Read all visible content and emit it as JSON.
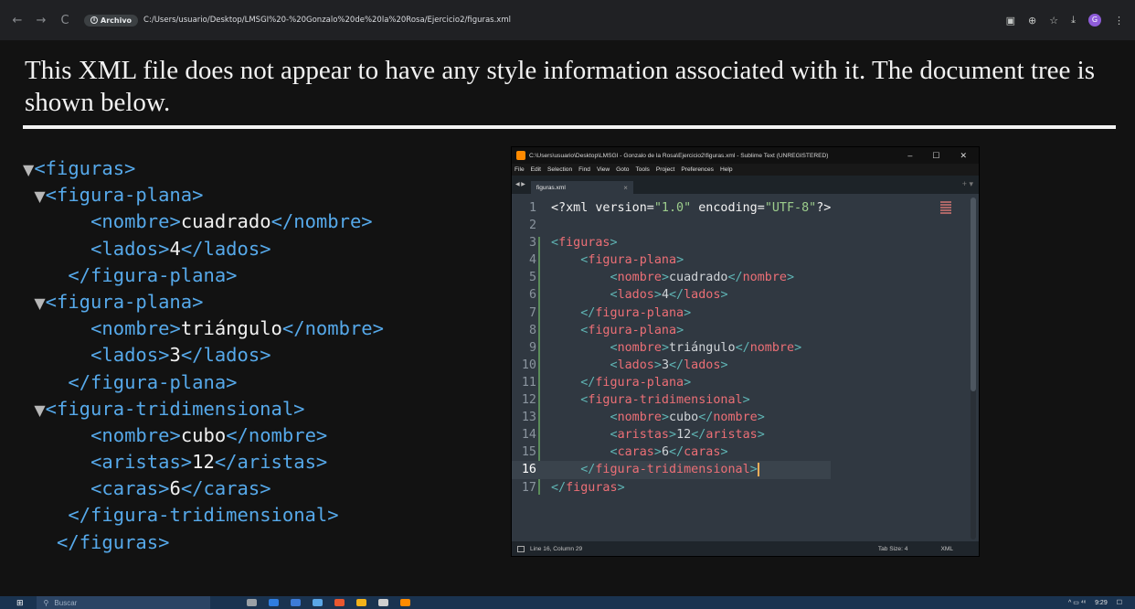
{
  "browser": {
    "back_icon": "←",
    "forward_icon": "→",
    "reload_icon": "C",
    "archivo_label": "Archivo",
    "url": "C:/Users/usuario/Desktop/LMSGI%20-%20Gonzalo%20de%20la%20Rosa/Ejercicio2/figuras.xml",
    "translate_icon": "▣",
    "zoom_icon": "⊕",
    "bookmark_icon": "☆",
    "download_icon": "⤓",
    "profile_initial": "G",
    "menu_icon": "⋮"
  },
  "xml_viewer": {
    "notice": "This XML file does not appear to have any style information associated with it. The document tree is shown below.",
    "tree": [
      {
        "indent": "",
        "tri": "▼",
        "open": "<figuras>",
        "text": "",
        "close": ""
      },
      {
        "indent": " ",
        "tri": "▼",
        "open": "<figura-plana>",
        "text": "",
        "close": ""
      },
      {
        "indent": "    ",
        "tri": "",
        "open": "<nombre>",
        "text": "cuadrado",
        "close": "</nombre>"
      },
      {
        "indent": "    ",
        "tri": "",
        "open": "<lados>",
        "text": "4",
        "close": "</lados>"
      },
      {
        "indent": "  ",
        "tri": "",
        "open": "</figura-plana>",
        "text": "",
        "close": ""
      },
      {
        "indent": " ",
        "tri": "▼",
        "open": "<figura-plana>",
        "text": "",
        "close": ""
      },
      {
        "indent": "    ",
        "tri": "",
        "open": "<nombre>",
        "text": "triángulo",
        "close": "</nombre>"
      },
      {
        "indent": "    ",
        "tri": "",
        "open": "<lados>",
        "text": "3",
        "close": "</lados>"
      },
      {
        "indent": "  ",
        "tri": "",
        "open": "</figura-plana>",
        "text": "",
        "close": ""
      },
      {
        "indent": " ",
        "tri": "▼",
        "open": "<figura-tridimensional>",
        "text": "",
        "close": ""
      },
      {
        "indent": "    ",
        "tri": "",
        "open": "<nombre>",
        "text": "cubo",
        "close": "</nombre>"
      },
      {
        "indent": "    ",
        "tri": "",
        "open": "<aristas>",
        "text": "12",
        "close": "</aristas>"
      },
      {
        "indent": "    ",
        "tri": "",
        "open": "<caras>",
        "text": "6",
        "close": "</caras>"
      },
      {
        "indent": "  ",
        "tri": "",
        "open": "</figura-tridimensional>",
        "text": "",
        "close": ""
      },
      {
        "indent": " ",
        "tri": "",
        "open": "</figuras>",
        "text": "",
        "close": ""
      }
    ]
  },
  "sublime": {
    "title": "C:\\Users\\usuario\\Desktop\\LMSGI - Gonzalo de la Rosa\\Ejercicio2\\figuras.xml - Sublime Text (UNREGISTERED)",
    "minimize_icon": "–",
    "maximize_icon": "☐",
    "close_icon": "✕",
    "menu": [
      "File",
      "Edit",
      "Selection",
      "Find",
      "View",
      "Goto",
      "Tools",
      "Project",
      "Preferences",
      "Help"
    ],
    "tab_nav": "◀ ▶",
    "tab_name": "figuras.xml",
    "tab_close": "×",
    "tab_add": "+ ▾",
    "current_line": 16,
    "code": [
      {
        "n": "1",
        "ind": "",
        "kind": "decl",
        "a": "<?xml version=",
        "b": "\"1.0\"",
        "c": " encoding=",
        "d": "\"UTF-8\"",
        "e": "?>"
      },
      {
        "n": "2",
        "ind": "",
        "kind": "blank"
      },
      {
        "n": "3",
        "ind": "",
        "kind": "tag",
        "open": "figuras"
      },
      {
        "n": "4",
        "ind": "    ",
        "kind": "tag",
        "open": "figura-plana"
      },
      {
        "n": "5",
        "ind": "        ",
        "kind": "el",
        "tag": "nombre",
        "val": "cuadrado"
      },
      {
        "n": "6",
        "ind": "        ",
        "kind": "el",
        "tag": "lados",
        "val": "4"
      },
      {
        "n": "7",
        "ind": "    ",
        "kind": "end",
        "close": "figura-plana"
      },
      {
        "n": "8",
        "ind": "    ",
        "kind": "tag",
        "open": "figura-plana"
      },
      {
        "n": "9",
        "ind": "        ",
        "kind": "el",
        "tag": "nombre",
        "val": "triángulo"
      },
      {
        "n": "10",
        "ind": "        ",
        "kind": "el",
        "tag": "lados",
        "val": "3"
      },
      {
        "n": "11",
        "ind": "    ",
        "kind": "end",
        "close": "figura-plana"
      },
      {
        "n": "12",
        "ind": "    ",
        "kind": "tag",
        "open": "figura-tridimensional"
      },
      {
        "n": "13",
        "ind": "        ",
        "kind": "el",
        "tag": "nombre",
        "val": "cubo"
      },
      {
        "n": "14",
        "ind": "        ",
        "kind": "el",
        "tag": "aristas",
        "val": "12"
      },
      {
        "n": "15",
        "ind": "        ",
        "kind": "el",
        "tag": "caras",
        "val": "6"
      },
      {
        "n": "16",
        "ind": "    ",
        "kind": "end",
        "close": "figura-tridimensional"
      },
      {
        "n": "17",
        "ind": "",
        "kind": "end",
        "close": "figuras"
      }
    ],
    "status_left": "Line 16, Column 29",
    "tab_size": "Tab Size: 4",
    "syntax": "XML"
  },
  "taskbar": {
    "start_icon": "⊞",
    "search_icon": "⚲",
    "search_placeholder": "Buscar",
    "apps": [
      "#9aa0a6",
      "#2f7de1",
      "#3d7bd8",
      "#5aa6e6",
      "#e9572f",
      "#f2b21b",
      "#cfcfcf",
      "#ff8a00"
    ],
    "tray_icons": "^ ▭ ⁴ˣ",
    "time": "9:29",
    "notification_icon": "☐"
  },
  "colors": {
    "tag": "#ec6f76",
    "punct": "#5fb4b4",
    "string": "#9ccd8c",
    "tree_tag": "#56a9ea"
  }
}
